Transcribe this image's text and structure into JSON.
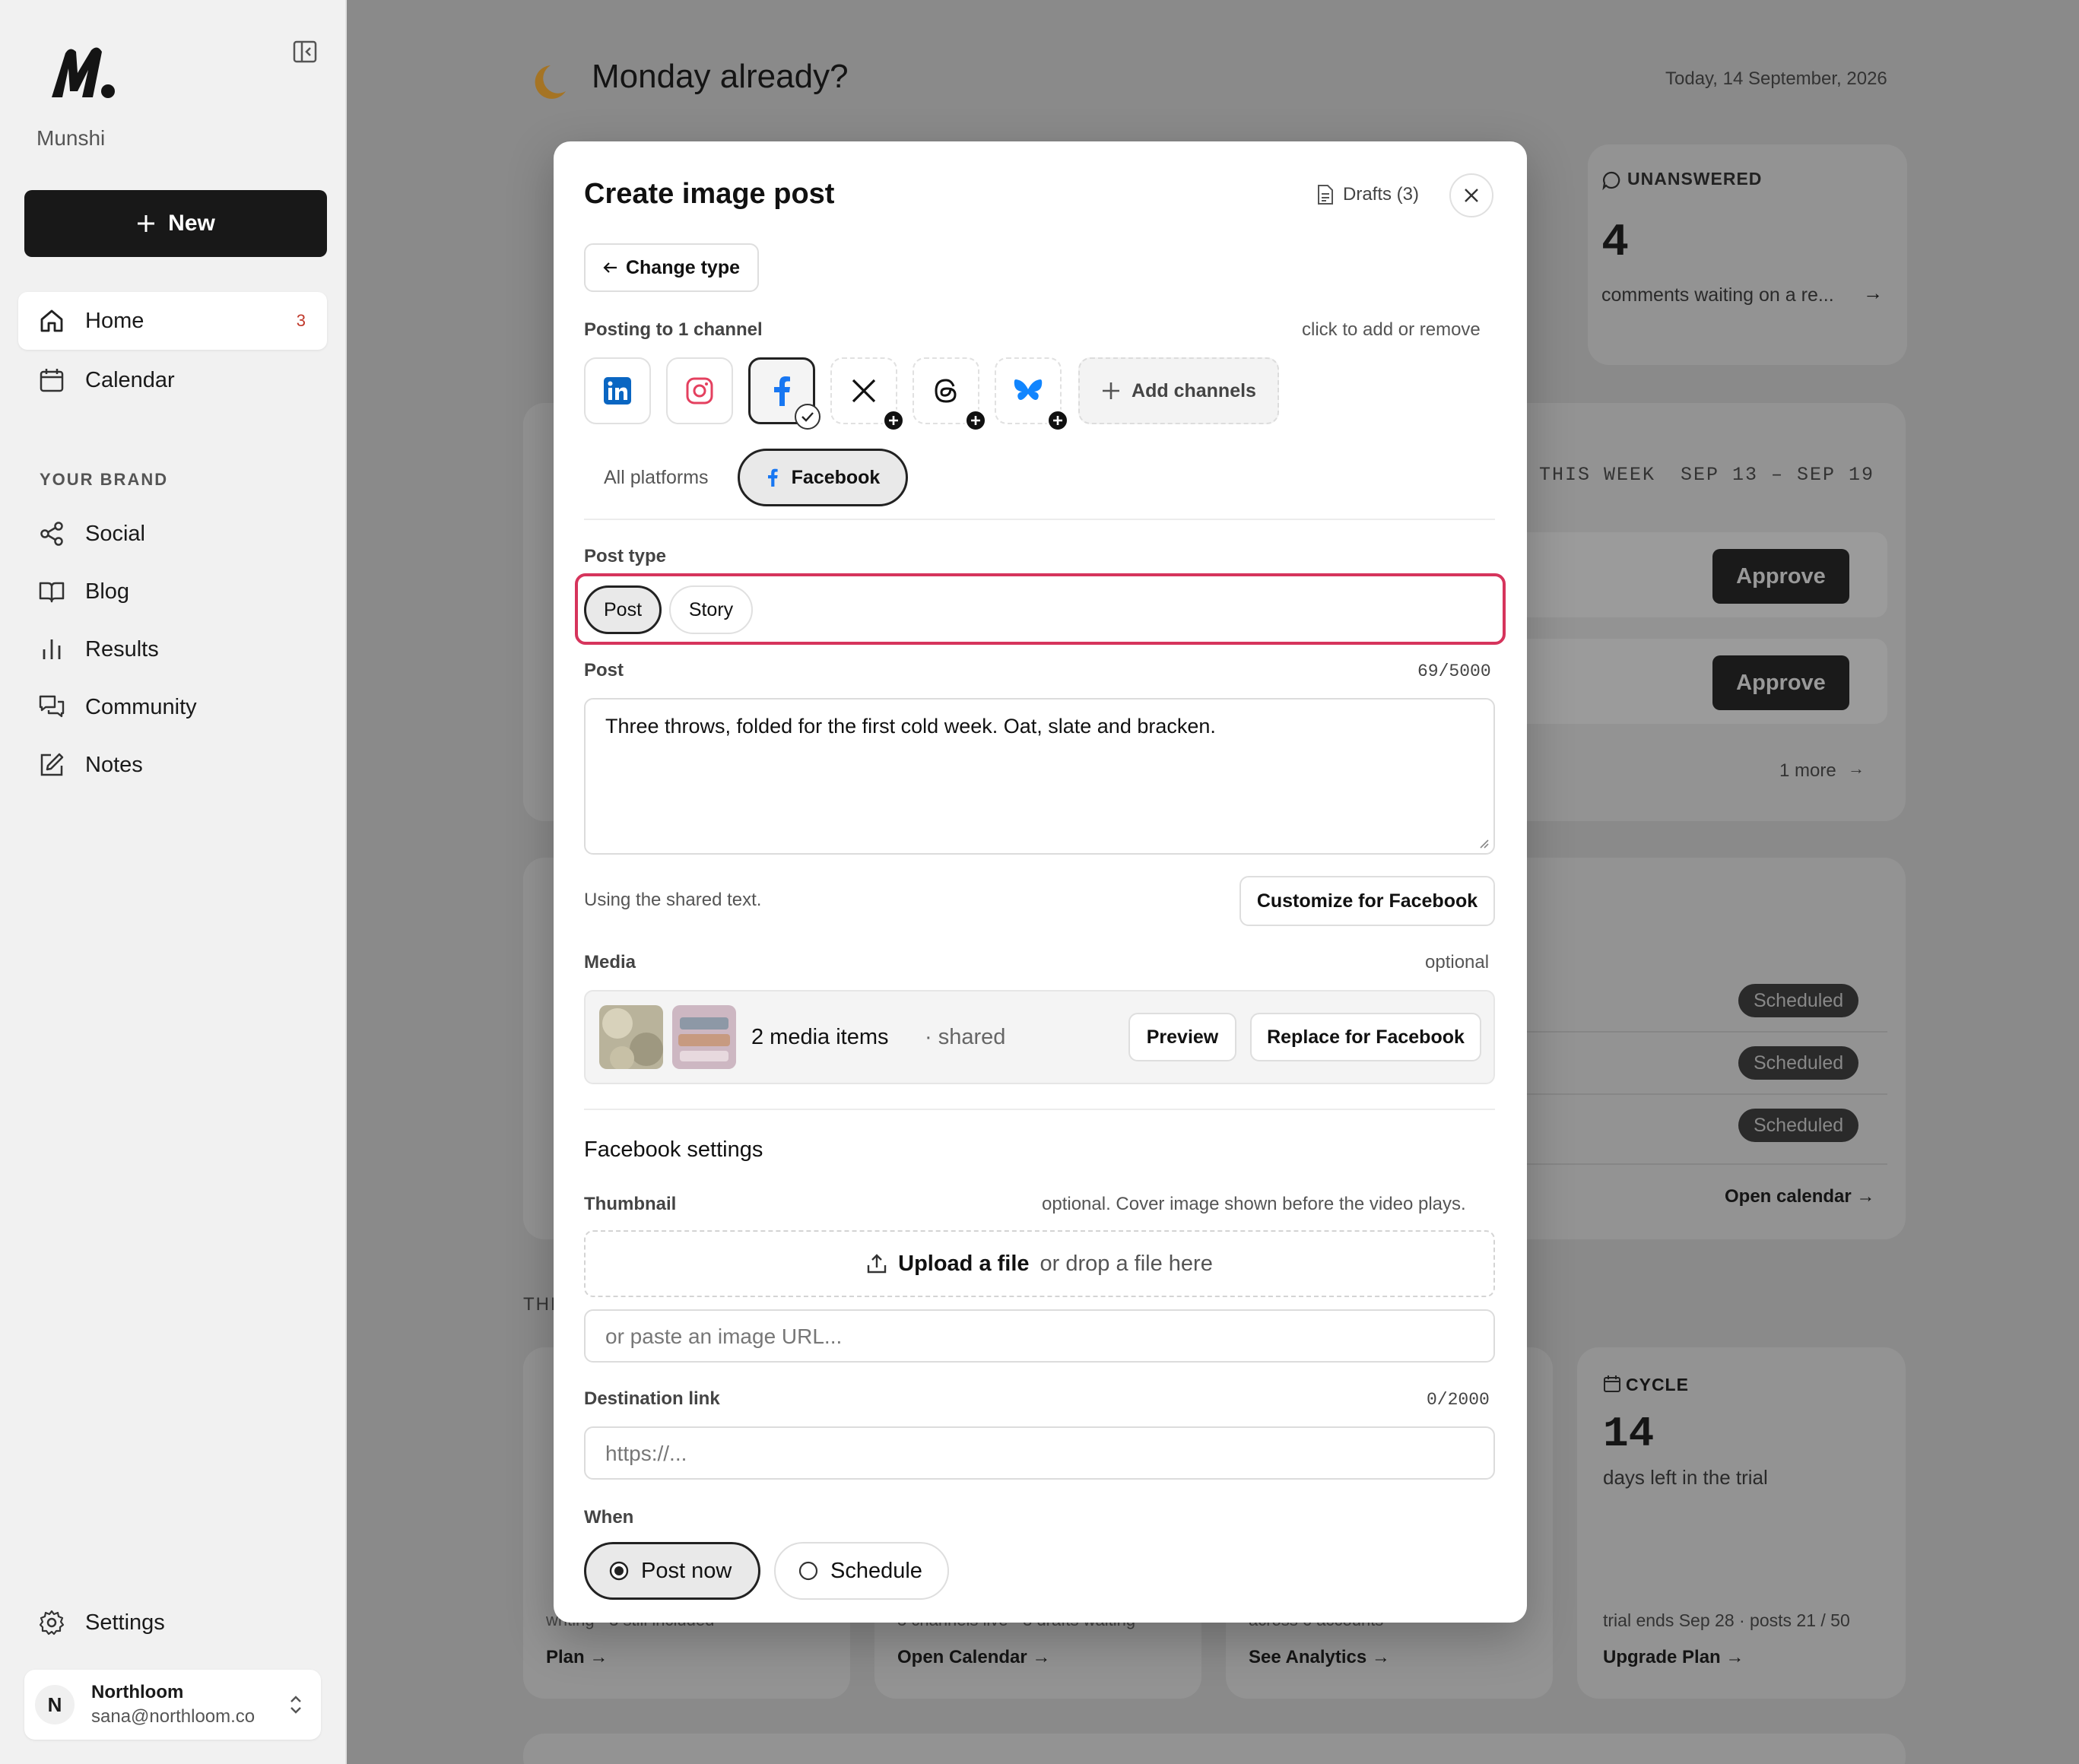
{
  "sidebar": {
    "brand": "Munshi",
    "new_label": "New",
    "nav": [
      {
        "label": "Home",
        "badge": "3"
      },
      {
        "label": "Calendar"
      }
    ],
    "section_label": "YOUR BRAND",
    "brand_items": [
      {
        "label": "Social"
      },
      {
        "label": "Blog"
      },
      {
        "label": "Results"
      },
      {
        "label": "Community"
      },
      {
        "label": "Notes"
      }
    ],
    "settings_label": "Settings",
    "account": {
      "initial": "N",
      "name": "Northloom",
      "email": "sana@northloom.co"
    }
  },
  "dashboard": {
    "greeting": "Monday already?",
    "date": "Today, 14 September, 2026",
    "unanswered": {
      "title": "UNANSWERED",
      "value": "4",
      "desc": "comments waiting on a re..."
    },
    "week": {
      "label": "THIS WEEK",
      "range": "SEP 13 – SEP 19",
      "approve_label": "Approve",
      "more": "1 more"
    },
    "scheduled_label": "Scheduled",
    "open_calendar": "Open calendar →",
    "section_frag": "THI",
    "cycle": {
      "title": "CYCLE",
      "value": "14",
      "desc": "days left in the trial",
      "footer": "trial ends Sep 28 · posts 21 / 50",
      "link": "Upgrade Plan →"
    },
    "bottom_links": [
      "Plan →",
      "Open Calendar →",
      "See Analytics →"
    ],
    "bottom_frags": [
      "writing · 3 still included",
      "3 channels live · 3 drafts waiting",
      "across 6 accounts"
    ]
  },
  "modal": {
    "title": "Create image post",
    "drafts_label": "Drafts (3)",
    "change_type_label": "Change type",
    "posting_to": "Posting to 1 channel",
    "posting_hint": "click to add or remove",
    "channels": [
      {
        "name": "LinkedIn",
        "icon": "linkedin-icon",
        "state": "available",
        "color": "#0a66c2"
      },
      {
        "name": "Instagram",
        "icon": "instagram-icon",
        "state": "available",
        "color": "#e4405f"
      },
      {
        "name": "Facebook",
        "icon": "facebook-icon",
        "state": "selected",
        "color": "#1877f2"
      },
      {
        "name": "X",
        "icon": "x-icon",
        "state": "not-connected",
        "color": "#000000"
      },
      {
        "name": "Threads",
        "icon": "threads-icon",
        "state": "not-connected",
        "color": "#000000"
      },
      {
        "name": "Bluesky",
        "icon": "bluesky-icon",
        "state": "not-connected",
        "color": "#1185fe"
      }
    ],
    "add_channels_label": "Add channels",
    "platform_tabs": [
      "All platforms",
      "Facebook"
    ],
    "post_type_label": "Post type",
    "post_types": [
      "Post",
      "Story"
    ],
    "selected_post_type": "Post",
    "post_label": "Post",
    "post_count": "69/5000",
    "post_text": "Three throws, folded for the first cold week. Oat, slate and bracken.",
    "shared_text_note": "Using the shared text.",
    "customize_label": "Customize for Facebook",
    "media_label": "Media",
    "media_optional": "optional",
    "media_count": "2 media items",
    "media_shared": "· shared",
    "preview_label": "Preview",
    "replace_label": "Replace for Facebook",
    "fb_settings_label": "Facebook settings",
    "thumbnail_label": "Thumbnail",
    "thumbnail_hint": "optional. Cover image shown before the video plays.",
    "upload_label": "Upload a file",
    "upload_hint": "or drop a file here",
    "url_placeholder": "or paste an image URL...",
    "dest_label": "Destination link",
    "dest_count": "0/2000",
    "dest_placeholder": "https://...",
    "when_label": "When",
    "when_options": [
      "Post now",
      "Schedule"
    ],
    "when_selected": "Post now",
    "accent_highlight": "#d6345c"
  }
}
